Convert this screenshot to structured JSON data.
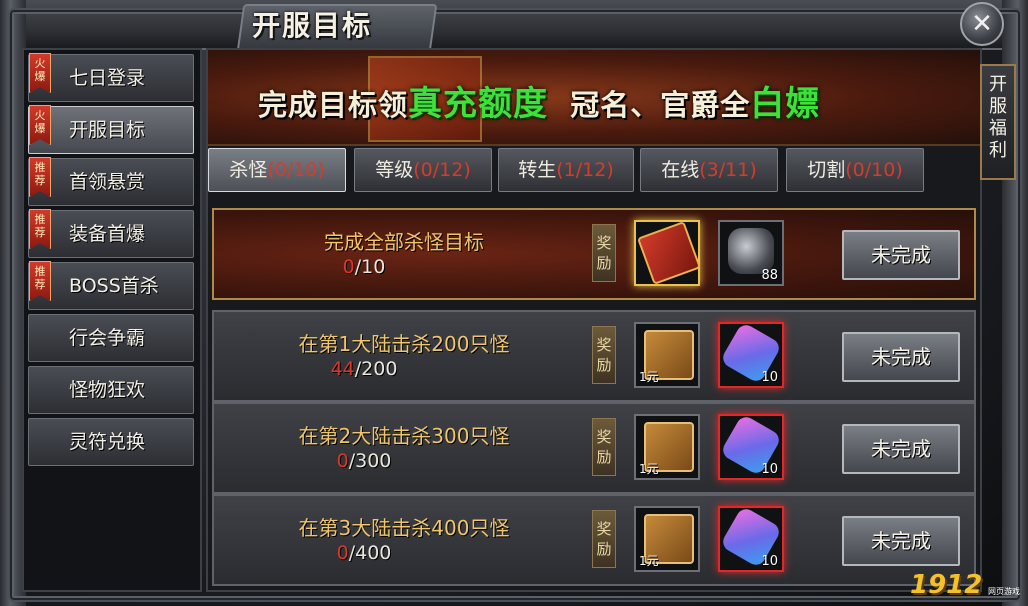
{
  "window": {
    "title": "开服目标",
    "close_glyph": "✕"
  },
  "sidebar": {
    "items": [
      {
        "label": "七日登录",
        "badge": "火爆",
        "active": false
      },
      {
        "label": "开服目标",
        "badge": "火爆",
        "active": true
      },
      {
        "label": "首领悬赏",
        "badge": "推荐",
        "active": false
      },
      {
        "label": "装备首爆",
        "badge": "推荐",
        "active": false
      },
      {
        "label": "BOSS首杀",
        "badge": "推荐",
        "active": false
      },
      {
        "label": "行会争霸",
        "badge": "",
        "active": false
      },
      {
        "label": "怪物狂欢",
        "badge": "",
        "active": false
      },
      {
        "label": "灵符兑换",
        "badge": "",
        "active": false
      }
    ]
  },
  "banner": {
    "part1": "完成目标领",
    "highlight1": "真充额度",
    "part2": "冠名、官爵全",
    "highlight2": "白嫖"
  },
  "tabs": [
    {
      "name": "杀怪",
      "count": "(0/10)",
      "active": true
    },
    {
      "name": "等级",
      "count": "(0/12)",
      "active": false
    },
    {
      "name": "转生",
      "count": "(1/12)",
      "active": false
    },
    {
      "name": "在线",
      "count": "(3/11)",
      "active": false
    },
    {
      "name": "切割",
      "count": "(0/10)",
      "active": false
    }
  ],
  "tasks": [
    {
      "name": "完成全部杀怪目标",
      "current": "0",
      "total": "/10",
      "reward_label": "奖励",
      "rewards": [
        {
          "icon": "title-scroll-icon",
          "qty": "",
          "note": "",
          "glow": "gold"
        },
        {
          "icon": "ore-icon",
          "qty": "88",
          "note": "",
          "glow": "none"
        }
      ],
      "status": "未完成"
    },
    {
      "name": "在第1大陆击杀200只怪",
      "current": "44",
      "total": "/200",
      "reward_label": "奖励",
      "rewards": [
        {
          "icon": "recharge-card-icon",
          "qty": "",
          "note": "1元",
          "glow": "none"
        },
        {
          "icon": "vial-icon",
          "qty": "10",
          "note": "",
          "glow": "red"
        }
      ],
      "status": "未完成"
    },
    {
      "name": "在第2大陆击杀300只怪",
      "current": "0",
      "total": "/300",
      "reward_label": "奖励",
      "rewards": [
        {
          "icon": "recharge-card-icon",
          "qty": "",
          "note": "1元",
          "glow": "none"
        },
        {
          "icon": "vial-icon",
          "qty": "10",
          "note": "",
          "glow": "red"
        }
      ],
      "status": "未完成"
    },
    {
      "name": "在第3大陆击杀400只怪",
      "current": "0",
      "total": "/400",
      "reward_label": "奖励",
      "rewards": [
        {
          "icon": "recharge-card-icon",
          "qty": "",
          "note": "1元",
          "glow": "none"
        },
        {
          "icon": "vial-icon",
          "qty": "10",
          "note": "",
          "glow": "red"
        }
      ],
      "status": "未完成"
    }
  ],
  "right_tab": {
    "label": "开服福利"
  },
  "watermark": {
    "logo": "1912",
    "sub": "网页游戏"
  }
}
